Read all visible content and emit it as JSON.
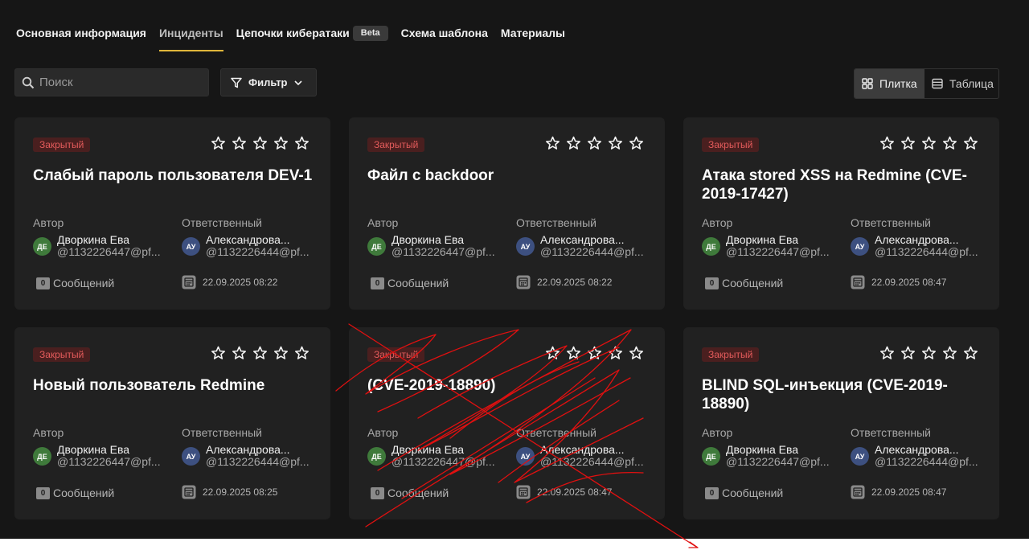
{
  "tabs": [
    {
      "label": "Основная информация"
    },
    {
      "label": "Инциденты"
    },
    {
      "label": "Цепочки кибератаки",
      "badge": "Beta"
    },
    {
      "label": "Схема шаблона"
    },
    {
      "label": "Материалы"
    }
  ],
  "active_tab": "Инциденты",
  "search": {
    "placeholder": "Поиск",
    "value": ""
  },
  "filter": {
    "label": "Фильтр"
  },
  "view": {
    "tile_label": "Плитка",
    "table_label": "Таблица",
    "selected": "Плитка"
  },
  "labels": {
    "author": "Автор",
    "responsible": "Ответственный",
    "messages": "Сообщений"
  },
  "cards": [
    {
      "status": "Закрытый",
      "rating": 0,
      "title": "Слабый пароль пользователя DEV-1",
      "author": {
        "initials": "ДЕ",
        "name": "Дворкина Ева",
        "handle": "@1132226447@pf..."
      },
      "responsible": {
        "initials": "АУ",
        "name": "Александрова...",
        "handle": "@1132226444@pf..."
      },
      "messages": "0",
      "date": "22.09.2025 08:22"
    },
    {
      "status": "Закрытый",
      "rating": 0,
      "title": "Файл с backdoor",
      "author": {
        "initials": "ДЕ",
        "name": "Дворкина Ева",
        "handle": "@1132226447@pf..."
      },
      "responsible": {
        "initials": "АУ",
        "name": "Александрова...",
        "handle": "@1132226444@pf..."
      },
      "messages": "0",
      "date": "22.09.2025 08:22"
    },
    {
      "status": "Закрытый",
      "rating": 0,
      "title": "Атака stored XSS на Redmine (CVE-2019-17427)",
      "author": {
        "initials": "ДЕ",
        "name": "Дворкина Ева",
        "handle": "@1132226447@pf..."
      },
      "responsible": {
        "initials": "АУ",
        "name": "Александрова...",
        "handle": "@1132226444@pf..."
      },
      "messages": "0",
      "date": "22.09.2025 08:47"
    },
    {
      "status": "Закрытый",
      "rating": 0,
      "title": "Новый пользователь Redmine",
      "author": {
        "initials": "ДЕ",
        "name": "Дворкина Ева",
        "handle": "@1132226447@pf..."
      },
      "responsible": {
        "initials": "АУ",
        "name": "Александрова...",
        "handle": "@1132226444@pf..."
      },
      "messages": "0",
      "date": "22.09.2025 08:25"
    },
    {
      "status": "Закрытый",
      "rating": 0,
      "title": "(CVE-2019-18890)",
      "author": {
        "initials": "ДЕ",
        "name": "Дворкина Ева",
        "handle": "@1132226447@pf..."
      },
      "responsible": {
        "initials": "АУ",
        "name": "Александрова...",
        "handle": "@1132226444@pf..."
      },
      "messages": "0",
      "date": "22.09.2025 08:47"
    },
    {
      "status": "Закрытый",
      "rating": 0,
      "title": "BLIND SQL-инъекция (CVE-2019-18890)",
      "author": {
        "initials": "ДЕ",
        "name": "Дворкина Ева",
        "handle": "@1132226447@pf..."
      },
      "responsible": {
        "initials": "АУ",
        "name": "Александрова...",
        "handle": "@1132226444@pf..."
      },
      "messages": "0",
      "date": "22.09.2025 08:47"
    }
  ],
  "colors": {
    "background": "#161616",
    "card": "#212121",
    "accent": "#e0b63a",
    "status_closed": "#e35b5b",
    "annotation": "#e01010"
  }
}
